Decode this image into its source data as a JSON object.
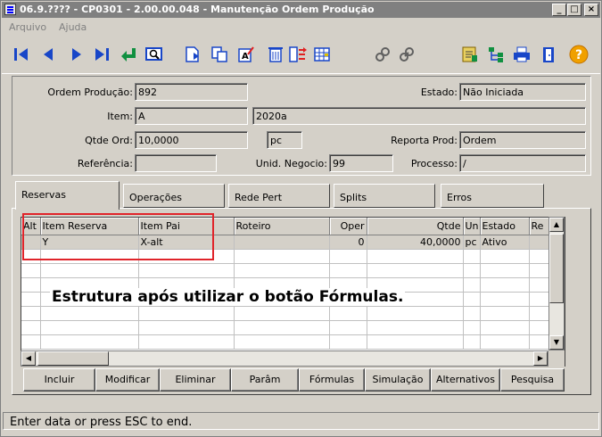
{
  "window": {
    "title": "06.9.???? - CP0301 - 2.00.00.048 - Manutenção Ordem Produção",
    "minimize_glyph": "_",
    "maximize_glyph": "□",
    "close_glyph": "×"
  },
  "menu": {
    "items": [
      "Arquivo",
      "Ajuda"
    ]
  },
  "toolbar": {
    "icons": [
      "first-record-icon",
      "previous-record-icon",
      "next-record-icon",
      "last-record-icon",
      "return-icon",
      "zoom-icon",
      "new-icon",
      "copy-icon",
      "edit-icon",
      "delete-icon",
      "swap-icon",
      "grid-icon",
      "link-icon",
      "chain-icon",
      "report-icon",
      "tree-icon",
      "print-icon",
      "exit-icon",
      "help-icon"
    ]
  },
  "header": {
    "ordem_producao": {
      "label": "Ordem Produção:",
      "value": "892"
    },
    "estado": {
      "label": "Estado:",
      "value": "Não Iniciada"
    },
    "item": {
      "label": "Item:",
      "value": "A",
      "desc": "2020a"
    },
    "qtde_ord": {
      "label": "Qtde Ord:",
      "value": "10,0000",
      "unit": "pc"
    },
    "reporta_prod": {
      "label": "Reporta Prod:",
      "value": "Ordem"
    },
    "referencia": {
      "label": "Referência:",
      "value": ""
    },
    "unid_negocio": {
      "label": "Unid. Negocio:",
      "value": "99"
    },
    "processo": {
      "label": "Processo:",
      "value": "/"
    }
  },
  "tabs": [
    "Reservas",
    "Operações",
    "Rede Pert",
    "Splits",
    "Erros"
  ],
  "grid": {
    "columns": [
      "Alt",
      "Item Reserva",
      "Item Pai",
      "Roteiro",
      "Oper",
      "Qtde",
      "Un",
      "Estado",
      "Re"
    ],
    "rows": [
      [
        "",
        "Y",
        "X-alt",
        "",
        "0",
        "40,0000",
        "pc",
        "Ativo",
        ""
      ]
    ]
  },
  "annotation": "Estrutura após utilizar o botão Fórmulas.",
  "buttons": [
    "Incluir",
    "Modificar",
    "Eliminar",
    "Parâm",
    "Fórmulas",
    "Simulação",
    "Alternativos",
    "Pesquisa"
  ],
  "status": "Enter data or press ESC to end.",
  "colors": {
    "annotation_border": "#e0242a",
    "title_bar": "#808080",
    "toolbar_blue": "#1846c8",
    "toolbar_green": "#109040"
  }
}
